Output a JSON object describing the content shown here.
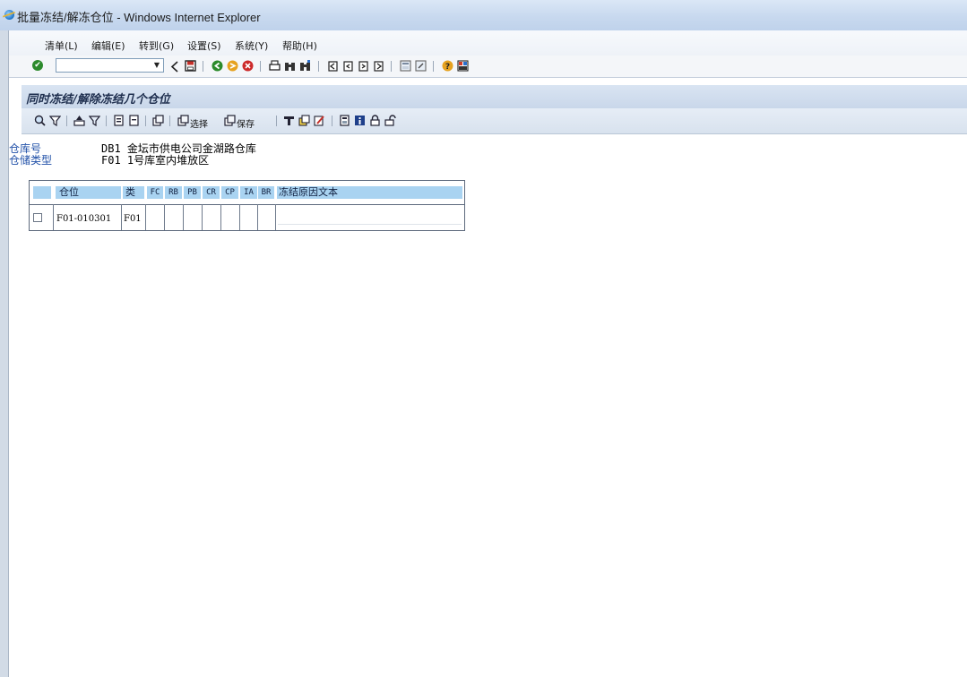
{
  "window": {
    "title": "批量冻结/解冻仓位 - Windows Internet Explorer",
    "icon": "ie-icon"
  },
  "menu": [
    {
      "label": "清单(L)"
    },
    {
      "label": "编辑(E)"
    },
    {
      "label": "转到(G)"
    },
    {
      "label": "设置(S)"
    },
    {
      "label": "系统(Y)"
    },
    {
      "label": "帮助(H)"
    }
  ],
  "command_field": {
    "value": "",
    "placeholder": ""
  },
  "screen": {
    "title": "同时冻结/解除冻结几个仓位"
  },
  "app_toolbar": {
    "select_label": "选择",
    "save_label": "保存"
  },
  "header_fields": [
    {
      "label": "仓库号",
      "value": "DB1 金坛市供电公司金湖路仓库"
    },
    {
      "label": "仓储类型",
      "value": "F01 1号库室内堆放区"
    }
  ],
  "table": {
    "columns": [
      "仓位",
      "类",
      "FC",
      "RB",
      "PB",
      "CR",
      "CP",
      "IA",
      "BR",
      "冻结原因文本"
    ],
    "rows": [
      {
        "bin": "F01-010301",
        "type": "F01",
        "text": ""
      }
    ]
  },
  "colors": {
    "title_bar": "#c8d9ef",
    "screen_header": "#c9d7ea",
    "column_header": "#a9d3f1",
    "label_blue": "#2050a8",
    "background": "#ffffff"
  }
}
